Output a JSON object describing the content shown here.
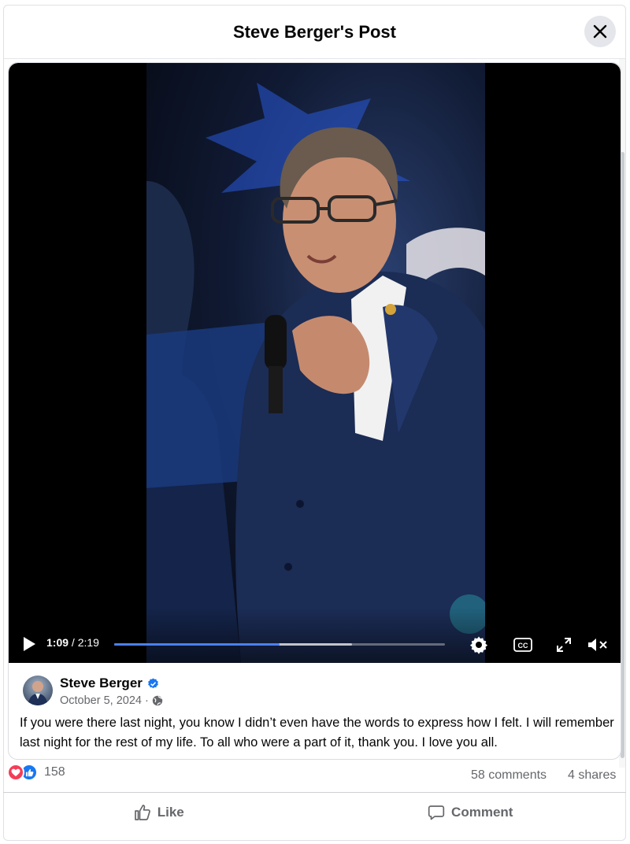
{
  "header": {
    "title": "Steve Berger's Post",
    "close_icon": "close-icon"
  },
  "video": {
    "current_time": "1:09",
    "duration": "/ 2:19",
    "played_fraction": 0.5,
    "buffered_fraction": 0.72,
    "icons": [
      "play-icon",
      "settings-icon",
      "captions-icon",
      "fullscreen-icon",
      "muted-volume-icon"
    ],
    "captions_label": "CC"
  },
  "post": {
    "author": "Steve Berger",
    "verified": true,
    "date": "October 5, 2024",
    "separator": "·",
    "audience_icon": "globe-icon",
    "text": "If you were there last night, you know I didn’t even have the words to express how I felt. I will remember last night for the rest of my life. To all who were a part of it, thank you. I love you all."
  },
  "stats": {
    "reaction_icons": [
      "love-reaction-icon",
      "like-reaction-icon"
    ],
    "reaction_count": "158",
    "comments": "58 comments",
    "shares": "4 shares"
  },
  "actions": {
    "like": "Like",
    "comment": "Comment"
  },
  "colors": {
    "accent": "#1877f2",
    "love": "#f33e58",
    "secondary_text": "#65676b",
    "progress": "#4a80f0"
  }
}
